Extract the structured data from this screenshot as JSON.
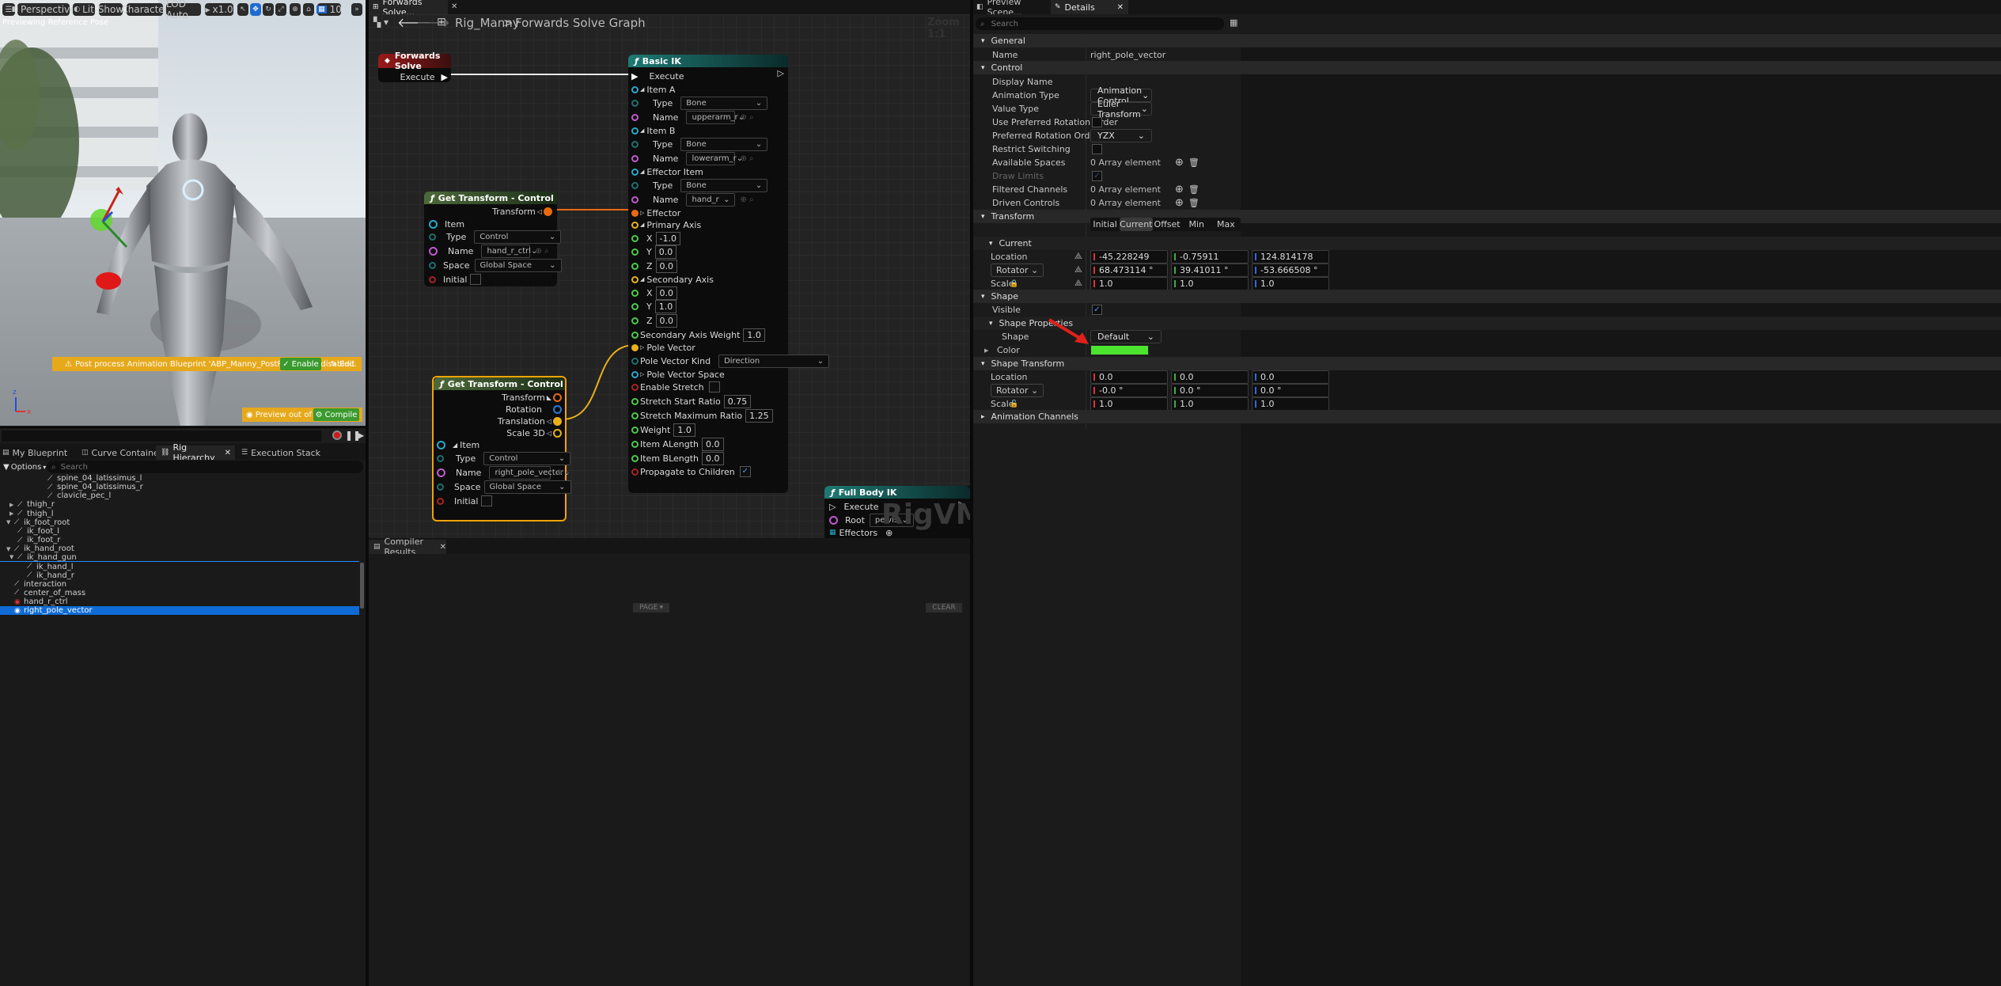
{
  "viewport": {
    "toolbar": {
      "perspective": "Perspective",
      "lit": "Lit",
      "show": "Show",
      "character": "Character",
      "lod": "LOD Auto",
      "speed": "x1.0",
      "grid_value": "10"
    },
    "status_text": "Previewing Reference Pose",
    "warning": {
      "text": "Post process Animation Blueprint 'ABP_Manny_PostProcess' is disabled.",
      "enable": "Enable",
      "edit": "Edit"
    },
    "preview_out_of_date": "Preview out of date",
    "compile": "Compile"
  },
  "bottom_left_tabs": [
    "My Blueprint",
    "Curve Container",
    "Rig Hierarchy",
    "Execution Stack"
  ],
  "hierarchy": {
    "options_label": "Options",
    "search_placeholder": "Search",
    "items": [
      {
        "label": "spine_04_latissimus_l",
        "depth": 4,
        "type": "bone"
      },
      {
        "label": "spine_04_latissimus_r",
        "depth": 4,
        "type": "bone"
      },
      {
        "label": "clavicle_pec_l",
        "depth": 4,
        "type": "bone"
      },
      {
        "label": "thigh_r",
        "depth": 1,
        "type": "bone"
      },
      {
        "label": "thigh_l",
        "depth": 1,
        "type": "bone"
      },
      {
        "label": "ik_foot_root",
        "depth": 0,
        "type": "bone"
      },
      {
        "label": "ik_foot_l",
        "depth": 1,
        "type": "bone"
      },
      {
        "label": "ik_foot_r",
        "depth": 1,
        "type": "bone"
      },
      {
        "label": "ik_hand_root",
        "depth": 0,
        "type": "bone"
      },
      {
        "label": "ik_hand_gun",
        "depth": 1,
        "type": "bone"
      },
      {
        "label": "ik_hand_l",
        "depth": 2,
        "type": "bone"
      },
      {
        "label": "ik_hand_r",
        "depth": 2,
        "type": "bone"
      },
      {
        "label": "interaction",
        "depth": 0,
        "type": "bone"
      },
      {
        "label": "center_of_mass",
        "depth": 0,
        "type": "bone"
      },
      {
        "label": "hand_r_ctrl",
        "depth": 0,
        "type": "control"
      },
      {
        "label": "right_pole_vector",
        "depth": 0,
        "type": "control"
      }
    ]
  },
  "graph": {
    "tab_title": "Forwards Solve...",
    "breadcrumb_root": "Rig_Manny",
    "breadcrumb_current": "Forwards Solve Graph",
    "zoom": "Zoom 1:1",
    "watermark": "RigVM",
    "forwards_solve": {
      "title": "Forwards Solve",
      "execute": "Execute"
    },
    "get_transform_1": {
      "title": "Get Transform - Control",
      "transform": "Transform",
      "item": "Item",
      "type_label": "Type",
      "type_value": "Control",
      "name_label": "Name",
      "name_value": "hand_r_ctrl",
      "space_label": "Space",
      "space_value": "Global Space",
      "initial": "Initial"
    },
    "get_transform_2": {
      "title": "Get Transform - Control",
      "transform": "Transform",
      "rotation": "Rotation",
      "translation": "Translation",
      "scale3d": "Scale 3D",
      "item": "Item",
      "type_label": "Type",
      "type_value": "Control",
      "name_label": "Name",
      "name_value": "right_pole_vector",
      "space_label": "Space",
      "space_value": "Global Space",
      "initial": "Initial"
    },
    "basic_ik": {
      "title": "Basic IK",
      "execute": "Execute",
      "item_a": "Item A",
      "item_a_type_label": "Type",
      "item_a_type": "Bone",
      "item_a_name_label": "Name",
      "item_a_name": "upperarm_r",
      "item_b": "Item B",
      "item_b_type_label": "Type",
      "item_b_type": "Bone",
      "item_b_name_label": "Name",
      "item_b_name": "lowerarm_r",
      "effector_item": "Effector Item",
      "eff_type_label": "Type",
      "eff_type": "Bone",
      "eff_name_label": "Name",
      "eff_name": "hand_r",
      "effector": "Effector",
      "primary_axis": "Primary Axis",
      "pa_x": "-1.0",
      "pa_y": "0.0",
      "pa_z": "0.0",
      "secondary_axis": "Secondary Axis",
      "sa_x": "0.0",
      "sa_y": "1.0",
      "sa_z": "0.0",
      "x_label": "X",
      "y_label": "Y",
      "z_label": "Z",
      "secondary_axis_weight": "Secondary Axis Weight",
      "secondary_axis_weight_value": "1.0",
      "pole_vector": "Pole Vector",
      "pole_vector_kind": "Pole Vector Kind",
      "pole_vector_kind_value": "Direction",
      "pole_vector_space": "Pole Vector Space",
      "enable_stretch": "Enable Stretch",
      "stretch_start_ratio": "Stretch Start Ratio",
      "stretch_start_ratio_value": "0.75",
      "stretch_max_ratio": "Stretch Maximum Ratio",
      "stretch_max_ratio_value": "1.25",
      "weight": "Weight",
      "weight_value": "1.0",
      "item_a_length": "Item ALength",
      "item_a_length_value": "0.0",
      "item_b_length": "Item BLength",
      "item_b_length_value": "0.0",
      "propagate": "Propagate to Children"
    },
    "full_body_ik": {
      "title": "Full Body IK",
      "execute": "Execute",
      "root": "Root",
      "root_value": "pelvis",
      "effectors": "Effectors"
    }
  },
  "compiler": {
    "tab": "Compiler Results",
    "page": "PAGE",
    "clear": "CLEAR"
  },
  "details": {
    "tab_preview": "Preview Scene...",
    "tab_details": "Details",
    "search_placeholder": "Search",
    "general": "General",
    "name_label": "Name",
    "name_value": "right_pole_vector",
    "control": "Control",
    "display_name": "Display Name",
    "animation_type": "Animation Type",
    "animation_type_value": "Animation Control",
    "value_type": "Value Type",
    "value_type_value": "Euler Transform",
    "use_pref_rot": "Use Preferred Rotation Order",
    "pref_rot": "Preferred Rotation Order",
    "pref_rot_value": "YZX",
    "restrict_switching": "Restrict Switching",
    "available_spaces": "Available Spaces",
    "available_spaces_value": "0 Array element",
    "draw_limits": "Draw Limits",
    "filtered_channels": "Filtered Channels",
    "filtered_channels_value": "0 Array element",
    "driven_controls": "Driven Controls",
    "driven_controls_value": "0 Array element",
    "transform": "Transform",
    "transform_tabs": [
      "Initial",
      "Current",
      "Offset",
      "Min",
      "Max"
    ],
    "current": "Current",
    "location": "Location",
    "loc": [
      "-45.228249",
      "-0.75911",
      "124.814178"
    ],
    "rotator": "Rotator",
    "rot": [
      "68.473114 °",
      "39.41011 °",
      "-53.666508 °"
    ],
    "scale": "Scale",
    "scl": [
      "1.0",
      "1.0",
      "1.0"
    ],
    "shape": "Shape",
    "visible": "Visible",
    "shape_properties": "Shape Properties",
    "shape_label": "Shape",
    "shape_value": "Default",
    "color_label": "Color",
    "shape_color": "#4ce42e",
    "shape_transform": "Shape Transform",
    "st_loc": [
      "0.0",
      "0.0",
      "0.0"
    ],
    "st_rot": [
      "-0.0 °",
      "0.0 °",
      "0.0 °"
    ],
    "st_scl": [
      "1.0",
      "1.0",
      "1.0"
    ],
    "animation_channels": "Animation Channels"
  }
}
